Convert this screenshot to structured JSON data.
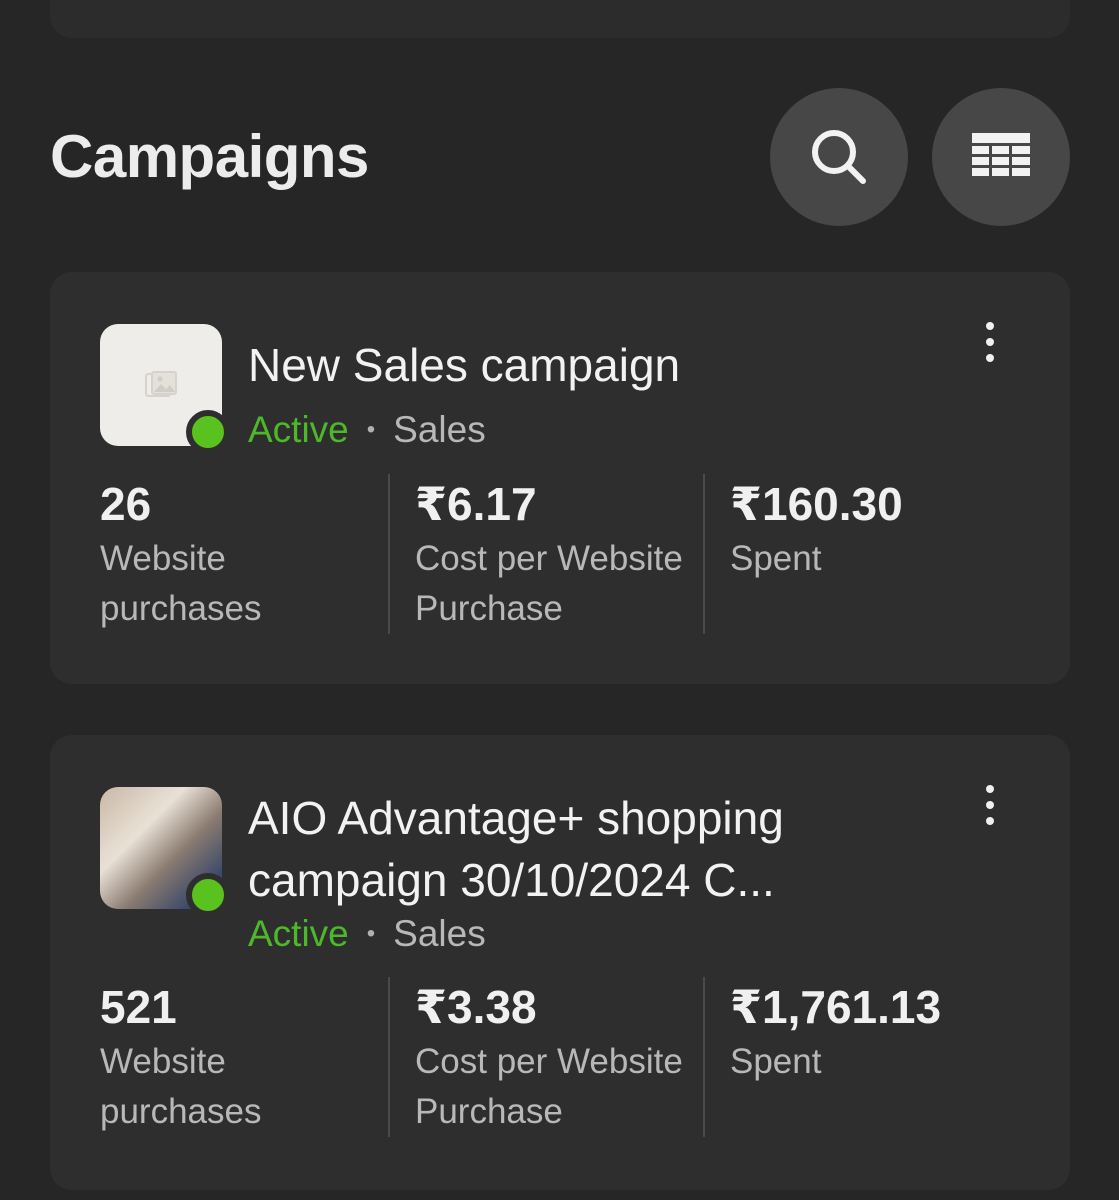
{
  "header": {
    "title": "Campaigns",
    "search_icon": "search-icon",
    "table_icon": "table-view-icon"
  },
  "colors": {
    "background": "#262626",
    "card": "#2e2e2e",
    "active": "#4cb82a",
    "status_dot": "#5ac21e"
  },
  "campaigns": [
    {
      "name": "New Sales campaign",
      "status": "Active",
      "separator": "•",
      "objective": "Sales",
      "thumbnail": "image-placeholder-icon",
      "metrics": [
        {
          "value": "26",
          "label": "Website purchases"
        },
        {
          "value": "₹6.17",
          "label": "Cost per Website Purchase"
        },
        {
          "value": "₹160.30",
          "label": "Spent"
        }
      ]
    },
    {
      "name": "AIO Advantage+ shopping campaign 30/10/2024 C...",
      "status": "Active",
      "separator": "•",
      "objective": "Sales",
      "thumbnail": "campaign-photo",
      "metrics": [
        {
          "value": "521",
          "label": "Website purchases"
        },
        {
          "value": "₹3.38",
          "label": "Cost per Website Purchase"
        },
        {
          "value": "₹1,761.13",
          "label": "Spent"
        }
      ]
    }
  ]
}
